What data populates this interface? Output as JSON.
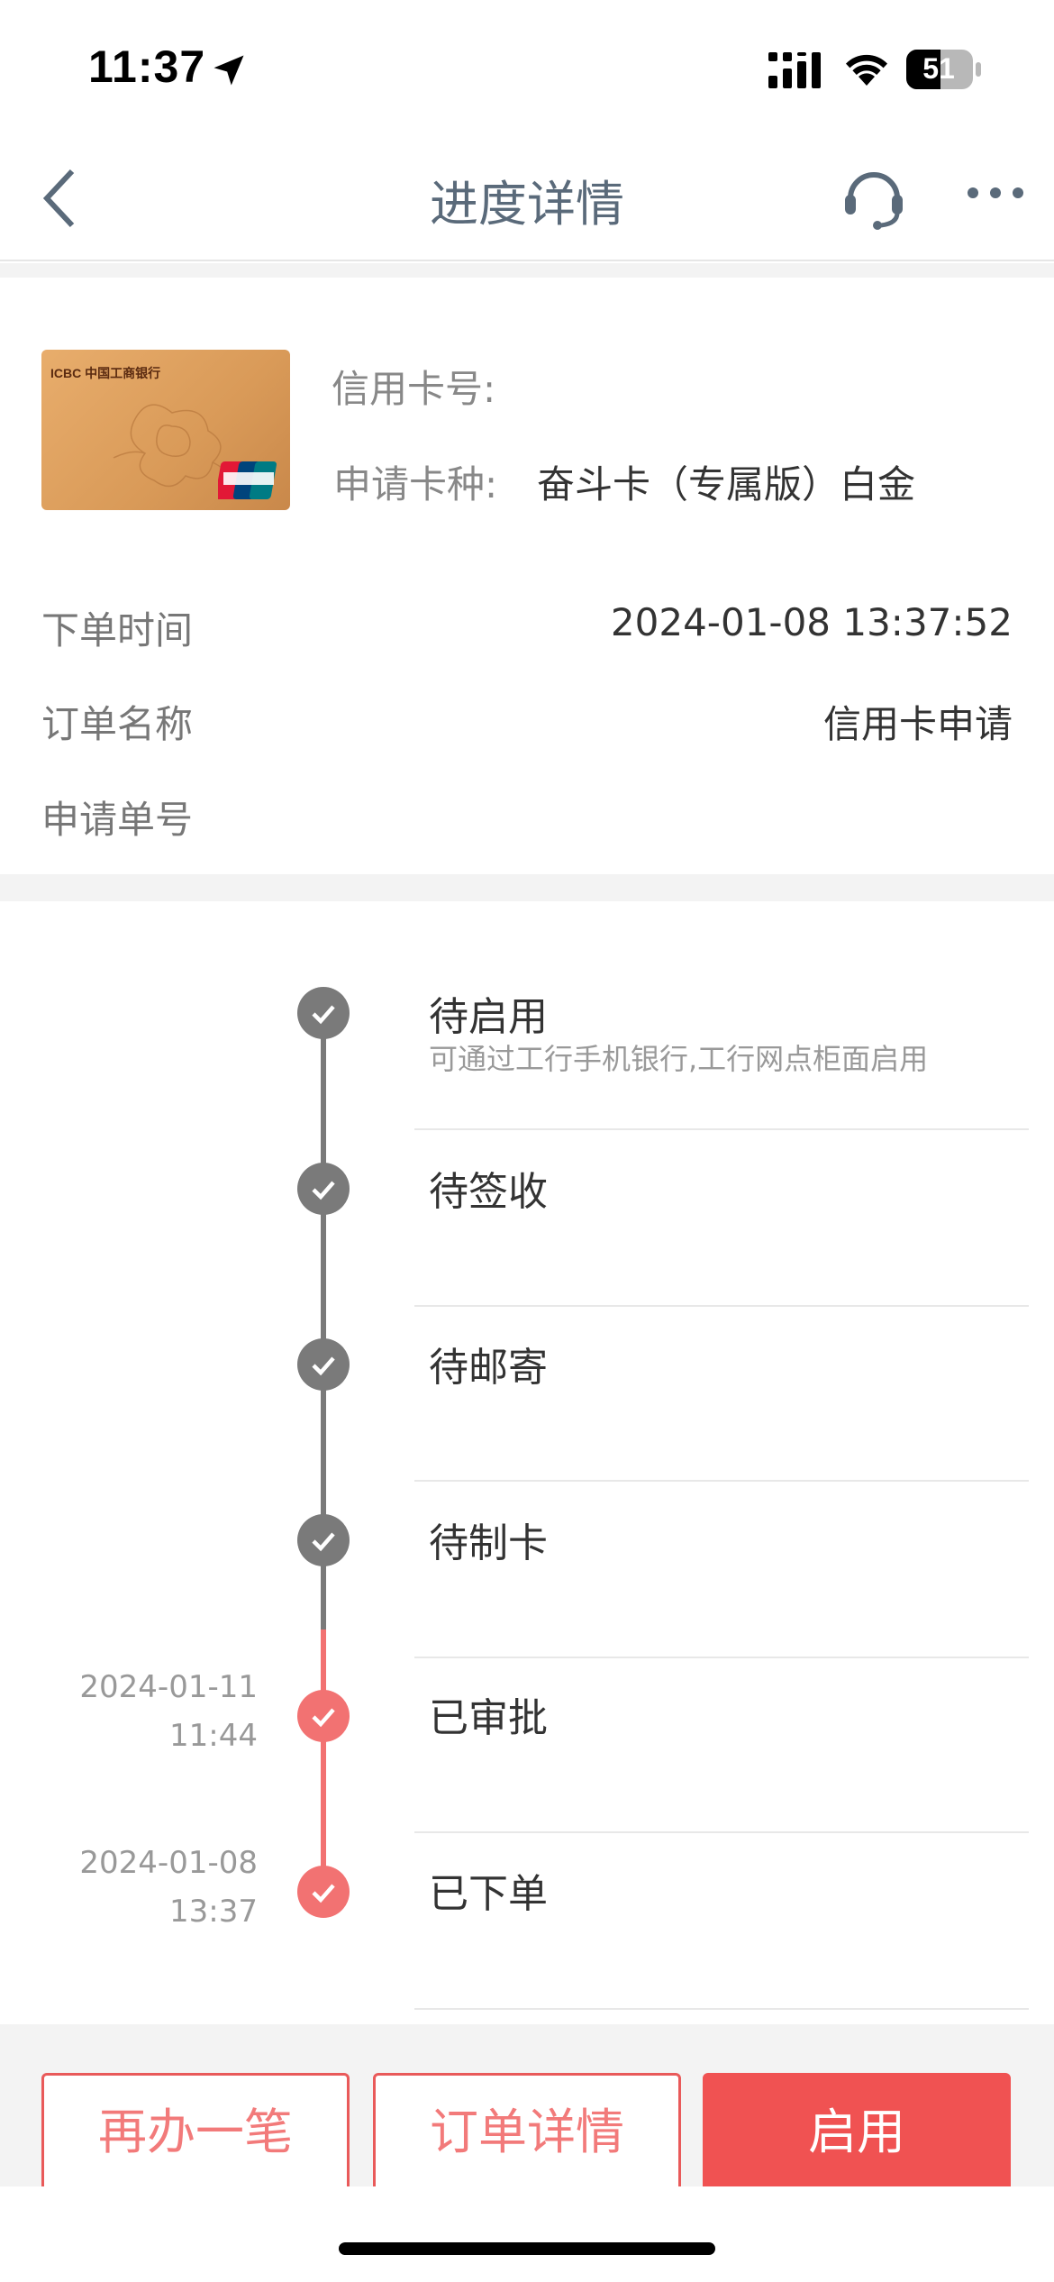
{
  "status_bar": {
    "time": "11:37",
    "battery": "51"
  },
  "nav": {
    "title": "进度详情",
    "icons": [
      "back-icon",
      "customer-service-icon",
      "more-icon"
    ]
  },
  "card": {
    "brand_text": "ICBC 中国工商银行",
    "card_number_label": "信用卡号:",
    "card_number_value": "",
    "card_type_label": "申请卡种:",
    "card_type_value": "奋斗卡（专属版）白金"
  },
  "order": {
    "rows": [
      {
        "label": "下单时间",
        "value": "2024-01-08 13:37:52"
      },
      {
        "label": "订单名称",
        "value": "信用卡申请"
      },
      {
        "label": "申请单号",
        "value": ""
      }
    ]
  },
  "timeline": {
    "steps": [
      {
        "title": "待启用",
        "subtitle": "可通过工行手机银行,工行网点柜面启用",
        "date": "",
        "time": "",
        "status": "pending"
      },
      {
        "title": "待签收",
        "subtitle": "",
        "date": "",
        "time": "",
        "status": "pending"
      },
      {
        "title": "待邮寄",
        "subtitle": "",
        "date": "",
        "time": "",
        "status": "pending"
      },
      {
        "title": "待制卡",
        "subtitle": "",
        "date": "",
        "time": "",
        "status": "pending"
      },
      {
        "title": "已审批",
        "subtitle": "",
        "date": "2024-01-11",
        "time": "11:44",
        "status": "done"
      },
      {
        "title": "已下单",
        "subtitle": "",
        "date": "2024-01-08",
        "time": "13:37",
        "status": "done"
      }
    ]
  },
  "buttons": {
    "again": "再办一笔",
    "details": "订单详情",
    "activate": "启用"
  },
  "colors": {
    "accent": "#f05252",
    "done": "#f27272",
    "pending": "#7a7a7a"
  }
}
